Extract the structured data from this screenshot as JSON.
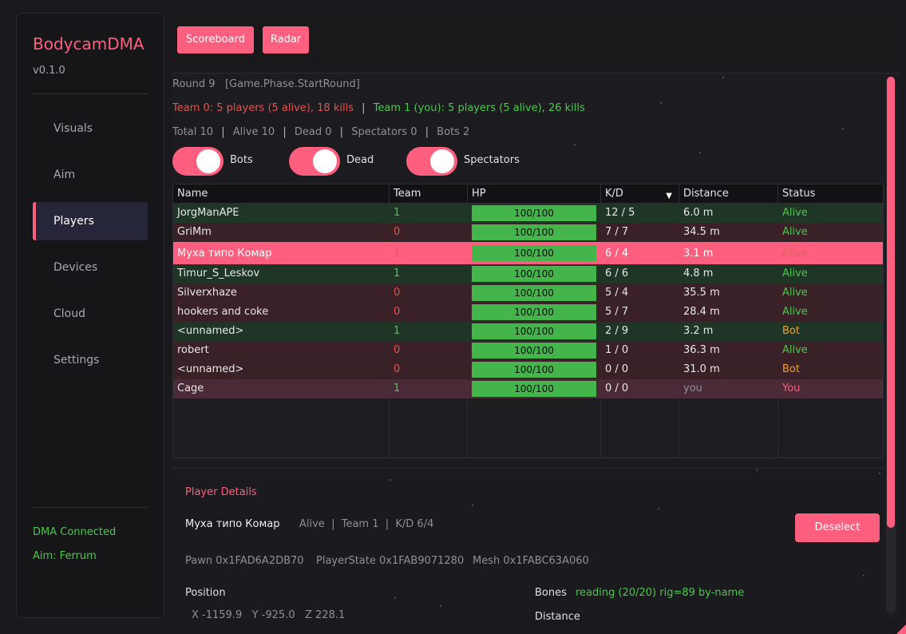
{
  "sidebar": {
    "brand": "BodycamDMA",
    "version": "v0.1.0",
    "nav": [
      "Visuals",
      "Aim",
      "Players",
      "Devices",
      "Cloud",
      "Settings"
    ],
    "active": "Players",
    "status_dma": "DMA Connected",
    "status_aim": "Aim: Ferrum"
  },
  "topbar": {
    "scoreboard": "Scoreboard",
    "radar": "Radar"
  },
  "round": {
    "label": "Round 9",
    "phase": "[Game.Phase.StartRound]"
  },
  "teams": {
    "team0": "Team 0: 5 players (5 alive), 18 kills",
    "sep": "|",
    "team1": "Team 1 (you): 5 players (5 alive), 26 kills"
  },
  "counts": {
    "total": "Total 10",
    "alive": "Alive 10",
    "dead": "Dead 0",
    "spectators": "Spectators 0",
    "bots": "Bots 2",
    "sep": "|"
  },
  "toggles": {
    "bots": "Bots",
    "dead": "Dead",
    "spectators": "Spectators"
  },
  "table": {
    "headers": {
      "name": "Name",
      "team": "Team",
      "hp": "HP",
      "kd": "K/D",
      "distance": "Distance",
      "status": "Status"
    },
    "sort_icon": "▼",
    "rows": [
      {
        "name": "JorgManAPE",
        "team": "1",
        "hp": "100/100",
        "kd": "12 / 5",
        "distance": "6.0 m",
        "status": "Alive"
      },
      {
        "name": "GriMm",
        "team": "0",
        "hp": "100/100",
        "kd": "7 / 7",
        "distance": "34.5 m",
        "status": "Alive"
      },
      {
        "name": "Муха типо Комар",
        "team": "1",
        "hp": "100/100",
        "kd": "6 / 4",
        "distance": "3.1 m",
        "status": "Alive"
      },
      {
        "name": "Timur_S_Leskov",
        "team": "1",
        "hp": "100/100",
        "kd": "6 / 6",
        "distance": "4.8 m",
        "status": "Alive"
      },
      {
        "name": "Silverxhaze",
        "team": "0",
        "hp": "100/100",
        "kd": "5 / 4",
        "distance": "35.5 m",
        "status": "Alive"
      },
      {
        "name": "hookers and coke",
        "team": "0",
        "hp": "100/100",
        "kd": "5 / 7",
        "distance": "28.4 m",
        "status": "Alive"
      },
      {
        "name": "<unnamed>",
        "team": "1",
        "hp": "100/100",
        "kd": "2 / 9",
        "distance": "3.2 m",
        "status": "Bot"
      },
      {
        "name": "robert",
        "team": "0",
        "hp": "100/100",
        "kd": "1 / 0",
        "distance": "36.3 m",
        "status": "Alive"
      },
      {
        "name": "<unnamed>",
        "team": "0",
        "hp": "100/100",
        "kd": "0 / 0",
        "distance": "31.0 m",
        "status": "Bot"
      },
      {
        "name": "Cage",
        "team": "1",
        "hp": "100/100",
        "kd": "0 / 0",
        "distance": "you",
        "status": "You"
      }
    ]
  },
  "details": {
    "title": "Player Details",
    "name": "Муха типо Комар",
    "meta": "Alive  |  Team 1  |  K/D 6/4",
    "pawn": "Pawn 0x1FAD6A2DB70",
    "player_state": "PlayerState 0x1FAB9071280",
    "mesh": "Mesh 0x1FABC63A060",
    "position_label": "Position",
    "position_value": "X -1159.9   Y -925.0   Z 228.1",
    "bones_label": "Bones",
    "bones_value": "reading (20/20) rig=89 by-name",
    "distance_label": "Distance",
    "deselect": "Deselect"
  },
  "colors": {
    "accent": "#ff5f7e",
    "team1_row": "#1f3526",
    "team0_row": "#3a2127",
    "selected_row": "#ff5f7e",
    "you_row": "#4a2a36",
    "hp_bar": "#43b54a",
    "alive": "#4cc64e",
    "bot": "#f0a030",
    "team0_text": "#e0534f",
    "team1_text": "#4cc64e"
  }
}
